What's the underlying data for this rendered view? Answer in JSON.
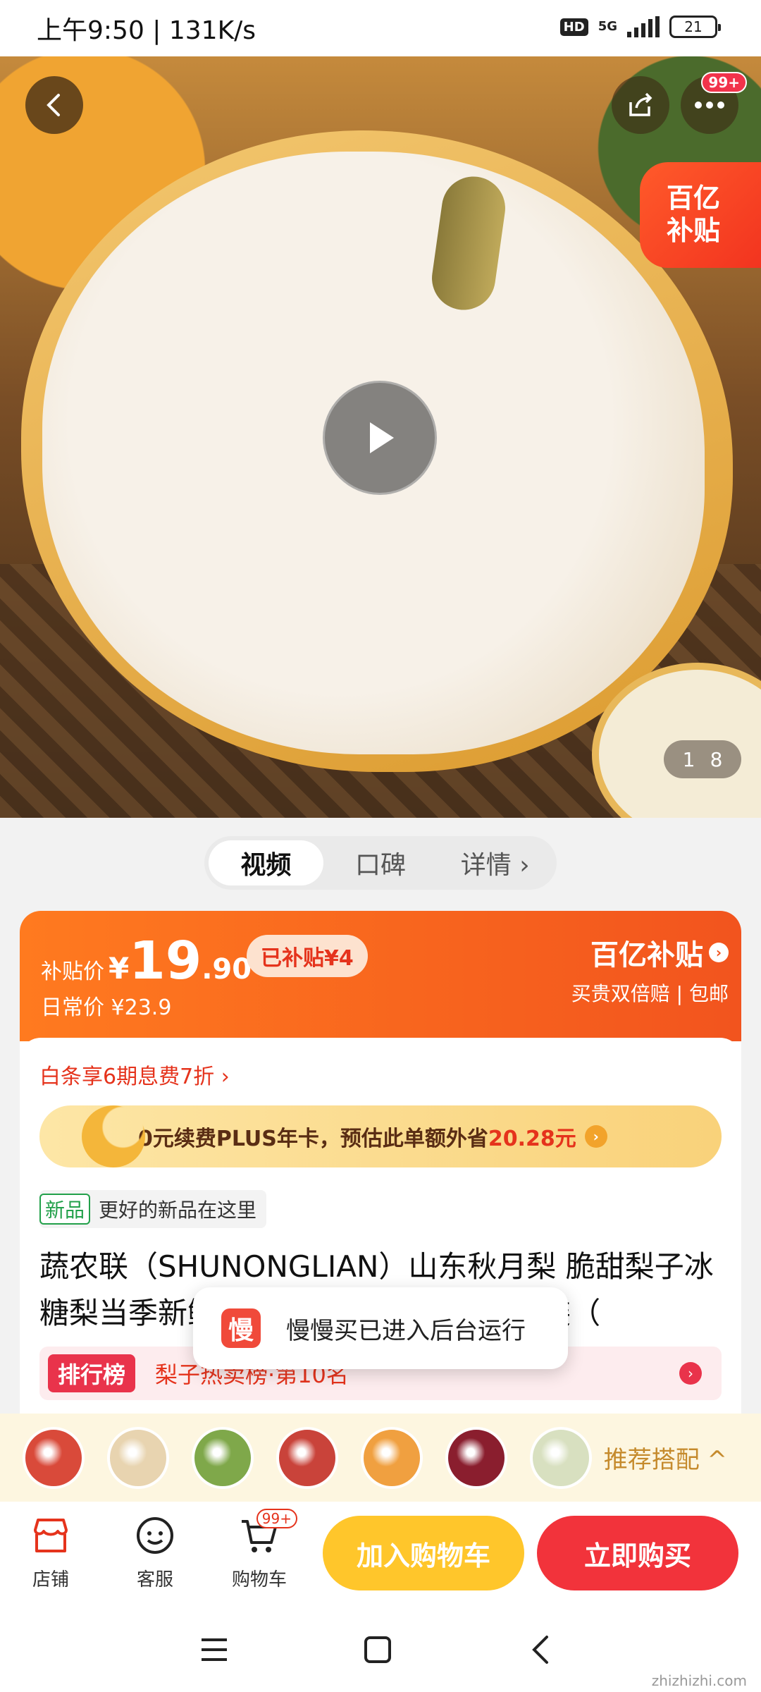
{
  "status_bar": {
    "time": "上午9:50 | 131K/s",
    "hd": "HD",
    "network": "5G",
    "battery": "21"
  },
  "hero": {
    "more_badge": "99+",
    "subsidy_tag_line1": "百亿",
    "subsidy_tag_line2": "补贴",
    "pager_current": "1",
    "pager_total": "8"
  },
  "tabs": [
    {
      "label": "视频"
    },
    {
      "label": "口碑"
    },
    {
      "label": "详情 ›"
    }
  ],
  "price": {
    "label": "补贴价",
    "currency": "¥",
    "integer": "19",
    "decimal": ".90",
    "subsidized": "已补贴¥4",
    "daily_price": "日常价 ¥23.9",
    "brand": "百亿补贴",
    "guarantee": "买贵双倍赔 | 包邮"
  },
  "promo": {
    "installment": "白条享6期息费7折 ›",
    "plus_prefix": "0元续费PLUS年卡，预估此单额外省",
    "plus_amount": "20.28元"
  },
  "product": {
    "new_tag": "新品",
    "new_text": "更好的新品在这里",
    "title": "蔬农联（SHUNONGLIAN）山东秋月梨 脆甜梨子冰糖梨当季新鲜水果生鲜中秋节礼盒 5斤装（",
    "rank_tag": "排行榜",
    "rank_text": "梨子热卖榜·第10名"
  },
  "toast": {
    "icon_char": "慢",
    "text": "慢慢买已进入后台运行"
  },
  "recommend": {
    "label": "推荐搭配 ^",
    "thumb_colors": [
      "#d94a3a",
      "#e8d4b0",
      "#7fa84a",
      "#c9433a",
      "#f0a040",
      "#8a1e2e",
      "#d8e0c0"
    ]
  },
  "bottom_nav": {
    "shop": "店铺",
    "service": "客服",
    "cart": "购物车",
    "cart_badge": "99+",
    "add_to_cart": "加入购物车",
    "buy_now": "立即购买"
  },
  "watermark": "zhizhizhi.com"
}
